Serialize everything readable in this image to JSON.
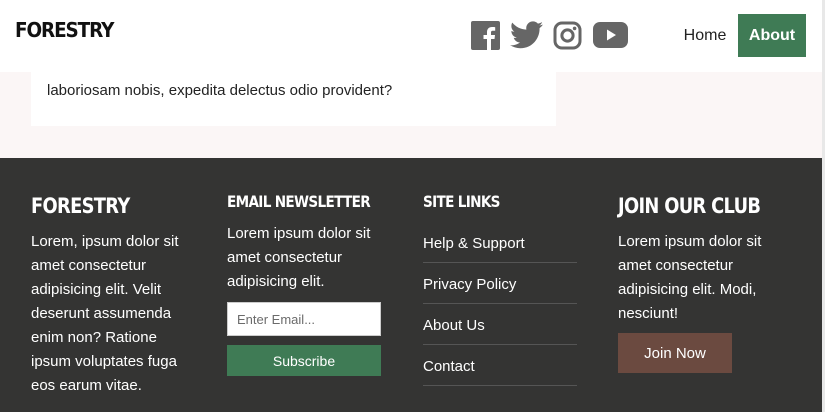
{
  "header": {
    "brand": "FORESTRY",
    "social": [
      {
        "icon": "facebook-icon"
      },
      {
        "icon": "twitter-icon"
      },
      {
        "icon": "instagram-icon"
      },
      {
        "icon": "youtube-icon"
      }
    ],
    "nav": {
      "home": "Home",
      "about": "About"
    }
  },
  "card": {
    "text": "laboriosam nobis, expedita delectus odio provident?"
  },
  "footer": {
    "about": {
      "title": "FORESTRY",
      "text": "Lorem, ipsum dolor sit amet consectetur adipisicing elit. Velit deserunt assumenda enim non? Ratione ipsum voluptates fuga eos earum vitae."
    },
    "newsletter": {
      "title": "EMAIL NEWSLETTER",
      "text": "Lorem ipsum dolor sit amet consectetur adipisicing elit.",
      "placeholder": "Enter Email...",
      "button": "Subscribe"
    },
    "site_links": {
      "title": "SITE LINKS",
      "items": [
        "Help & Support",
        "Privacy Policy",
        "About Us",
        "Contact"
      ]
    },
    "club": {
      "title": "JOIN OUR CLUB",
      "text": "Lorem ipsum dolor sit amet consectetur adipisicing elit. Modi, nesciunt!",
      "button": "Join Now"
    }
  },
  "colors": {
    "accent_green": "#3f7b55",
    "footer_bg": "#343433",
    "join_brown": "#6b4a40",
    "icon_gray": "#666666"
  }
}
